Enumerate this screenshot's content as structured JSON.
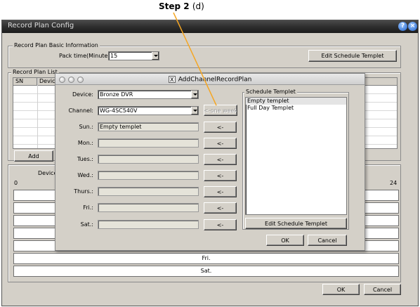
{
  "annotation": {
    "step_label": "Step 2",
    "step_sub": "(d)"
  },
  "window": {
    "title": "Record Plan Config"
  },
  "basic_info": {
    "legend": "Record Plan Basic Information",
    "pack_time_label": "Pack time(Minute):",
    "pack_time_value": "15",
    "edit_templet_button": "Edit Schedule Templet"
  },
  "plan_list": {
    "legend": "Record Plan List",
    "columns": [
      "SN",
      "Device"
    ],
    "add_button": "Add"
  },
  "timeline": {
    "device_label": "Device",
    "scale_start": "0",
    "scale_end": "24",
    "visible_labels": [
      "Fri.",
      "Sat."
    ]
  },
  "footer": {
    "ok_button": "OK",
    "cancel_button": "Cancel"
  },
  "dialog": {
    "title": "AddChannelRecordPlan",
    "device_label": "Device:",
    "device_value": "Bronze DVR",
    "channel_label": "Channel:",
    "channel_value": "WG-4SC540V",
    "one_week_button": "<-one week",
    "copy_button": "<-",
    "days": [
      {
        "label": "Sun.:",
        "value": "Empty templet"
      },
      {
        "label": "Mon.:",
        "value": ""
      },
      {
        "label": "Tues.:",
        "value": ""
      },
      {
        "label": "Wed.:",
        "value": ""
      },
      {
        "label": "Thurs.:",
        "value": ""
      },
      {
        "label": "Fri.:",
        "value": ""
      },
      {
        "label": "Sat.:",
        "value": ""
      }
    ],
    "templet_legend": "Schedule Templet",
    "templets": [
      "Empty templet",
      "Full Day Templet"
    ],
    "edit_templet_button": "Edit Schedule Templet",
    "ok_button": "OK",
    "cancel_button": "Cancel"
  }
}
